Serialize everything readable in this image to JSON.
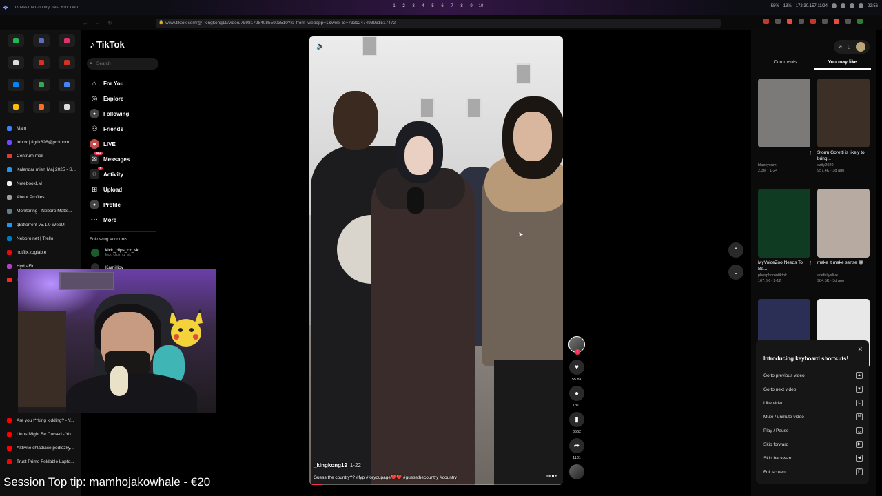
{
  "system_bar": {
    "window_title": "Guess the Country: Test Your Geo...",
    "workspaces": [
      "1",
      "2",
      "3",
      "4",
      "5",
      "6",
      "7",
      "8",
      "9",
      "10"
    ],
    "active_workspace": "2",
    "cpu": "58%",
    "mem": "18%",
    "ip": "172.30.157.11/24",
    "clock": "22:56"
  },
  "browser": {
    "url": "www.tiktok.com/@_kingkong19/video/7598179840855903510?is_from_webapp=1&web_id=7331247493931517472",
    "pinned_tabs": [
      {
        "icon": "spotify-icon",
        "color": "#1db954"
      },
      {
        "icon": "mail-icon",
        "color": "#5c6bc0"
      },
      {
        "icon": "instagram-icon",
        "color": "#e1306c"
      },
      {
        "icon": "x-icon",
        "color": "#dddddd"
      },
      {
        "icon": "gmail-icon",
        "color": "#d93025"
      },
      {
        "icon": "gmail-icon",
        "color": "#d93025"
      },
      {
        "icon": "messenger-icon",
        "color": "#0084ff"
      },
      {
        "icon": "drive-icon",
        "color": "#34a853"
      },
      {
        "icon": "chat-icon",
        "color": "#4285f4"
      },
      {
        "icon": "notes-icon",
        "color": "#fbbc04"
      },
      {
        "icon": "gitlab-icon",
        "color": "#fc6d26"
      },
      {
        "icon": "github-icon",
        "color": "#dddddd"
      }
    ],
    "tabs": [
      {
        "label": "Main",
        "color": "#3b82f6"
      },
      {
        "label": "Inbox | tigrik626@protonm...",
        "color": "#6d4aff"
      },
      {
        "label": "Centrum mail",
        "color": "#e53935"
      },
      {
        "label": "Kalendar mien Maj 2025 - S...",
        "color": "#2196f3"
      },
      {
        "label": "NotebookLM",
        "color": "#eeeeee"
      },
      {
        "label": "About Profiles",
        "color": "#9e9e9e"
      },
      {
        "label": "Monitoring - Neboro Matts...",
        "color": "#607d8b"
      },
      {
        "label": "qBittorrent v5.1.0 WebUI",
        "color": "#2196f3"
      },
      {
        "label": "Neboro.net | Trello",
        "color": "#0079bf"
      },
      {
        "label": "notflix.zoglab.e",
        "color": "#e50914"
      },
      {
        "label": "HydraFin",
        "color": "#ab47bc"
      },
      {
        "label": "Photos - Immich",
        "color": "#fa2921"
      }
    ],
    "bottom_tabs": [
      {
        "label": "Are you f**king kidding? - Y...",
        "color": "#ff0000"
      },
      {
        "label": "Linus Might Be Cursed - Yo...",
        "color": "#ff0000"
      },
      {
        "label": "Aktivne chladiace podlozky...",
        "color": "#ff0000"
      },
      {
        "label": "Trust Primo Foldable Lapto...",
        "color": "#ff0000"
      }
    ]
  },
  "tiktok_nav": {
    "logo": "TikTok",
    "search_placeholder": "Search",
    "menu": [
      {
        "label": "For You",
        "icon": "home-icon"
      },
      {
        "label": "Explore",
        "icon": "compass-icon"
      },
      {
        "label": "Following",
        "icon": "following-icon"
      },
      {
        "label": "Friends",
        "icon": "friends-icon"
      },
      {
        "label": "LIVE",
        "icon": "live-icon"
      },
      {
        "label": "Messages",
        "icon": "messages-icon",
        "badge": "99+"
      },
      {
        "label": "Activity",
        "icon": "activity-icon",
        "badge": "1"
      },
      {
        "label": "Upload",
        "icon": "upload-icon"
      },
      {
        "label": "Profile",
        "icon": "profile-icon"
      },
      {
        "label": "More",
        "icon": "more-icon"
      }
    ],
    "following_title": "Following accounts",
    "accounts": [
      {
        "name": "kick_clips_cz_sk",
        "handle": "kick_clips_cz_sk"
      },
      {
        "name": "Kamilljoy",
        "handle": ""
      }
    ]
  },
  "video": {
    "author": "_kingkong19",
    "date": "1-22",
    "caption": "Guess the country?? #fyp #foryoupage❤️❤️ #guessthecountry #country",
    "more_label": "more",
    "progress": 0.05
  },
  "actions": {
    "likes": "55.8K",
    "comments": "1311",
    "saves": "3662",
    "shares": "1131"
  },
  "right_panel": {
    "tabs": [
      "Comments",
      "You may like"
    ],
    "active_tab": "You may like",
    "cards": [
      {
        "title": "",
        "author": "blazeyeum",
        "meta": "2.3M · 1-24",
        "thumb": "#7b7a78"
      },
      {
        "title": "Storm Goretti is likely to bring...",
        "author": "ezity2020",
        "meta": "957.4K · 3d ago",
        "thumb": "#3c2f25"
      },
      {
        "title": "MyVoiceZoo Needs To Be...",
        "author": "phosphorontiktok",
        "meta": "167.6K · 2-12",
        "thumb": "#0f3b22"
      },
      {
        "title": "make it make sense 😂",
        "author": "acefullyalive",
        "meta": "984.5K · 3d ago",
        "thumb": "#b7aaa0"
      },
      {
        "title": "",
        "author": "",
        "meta": "",
        "thumb": "#2b2f55"
      },
      {
        "title": "",
        "author": "",
        "meta": "",
        "thumb": "#e8e8e8"
      }
    ]
  },
  "shortcuts": {
    "title": "Introducing keyboard shortcuts!",
    "items": [
      {
        "label": "Go to previous video",
        "key": "▲"
      },
      {
        "label": "Go to next video",
        "key": "▼"
      },
      {
        "label": "Like video",
        "key": "L"
      },
      {
        "label": "Mute / unmute video",
        "key": "M"
      },
      {
        "label": "Play / Pause",
        "key": "␣"
      },
      {
        "label": "Skip forward",
        "key": "▶"
      },
      {
        "label": "Skip backward",
        "key": "◀"
      },
      {
        "label": "Full screen",
        "key": "F"
      }
    ]
  },
  "overlay": {
    "tip": "Session Top tip: mamhojakowhale - €20"
  }
}
